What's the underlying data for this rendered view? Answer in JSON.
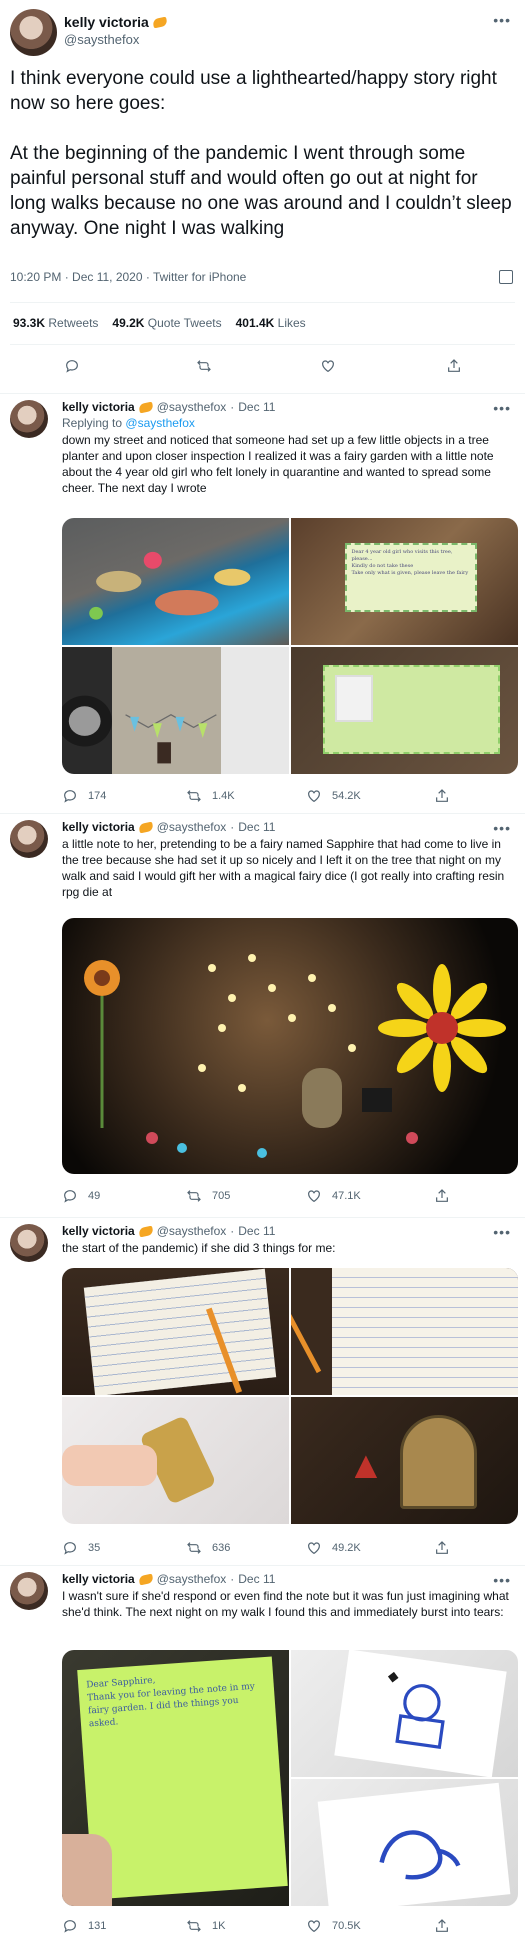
{
  "main": {
    "name": "kelly victoria",
    "handle": "@saysthefox",
    "text": "I think everyone could use a lighthearted/happy story right now so here goes:\n\nAt the beginning of the pandemic I went through some painful personal stuff and would often go out at night for long walks because no one was around and I couldn’t sleep anyway. One night I was walking",
    "meta": "10:20 PM · Dec 11, 2020 · Twitter for iPhone",
    "stats": {
      "retweets": "93.3K",
      "retweets_label": "Retweets",
      "quotes": "49.2K",
      "quotes_label": "Quote Tweets",
      "likes": "401.4K",
      "likes_label": "Likes"
    }
  },
  "replies": [
    {
      "name": "kelly victoria",
      "handle": "@saysthefox",
      "dot": "·",
      "date": "Dec 11",
      "replying_prefix": "Replying to",
      "replying_to": "@saysthefox",
      "text": "down my street and noticed that someone had set up a few little objects in a tree planter and upon closer inspection I realized it was a fairy garden with a little note about the 4 year old girl who felt lonely in quarantine and wanted to spread some cheer. The next day I wrote",
      "image_notes": [
        "Dear 4 year old girl who visits this tree, please...",
        "Kindly do not take these",
        "Take only what is given, please leave the fairy"
      ],
      "counts": {
        "replies": "174",
        "retweets": "1.4K",
        "likes": "54.2K"
      }
    },
    {
      "name": "kelly victoria",
      "handle": "@saysthefox",
      "dot": "·",
      "date": "Dec 11",
      "text": "a little note to her, pretending to be a fairy named Sapphire that had come to live in the tree because she had set it up so nicely and I left it on the tree that night on my walk and said I would gift her with a magical fairy dice (I got really into crafting resin rpg die at",
      "counts": {
        "replies": "49",
        "retweets": "705",
        "likes": "47.1K"
      }
    },
    {
      "name": "kelly victoria",
      "handle": "@saysthefox",
      "dot": "·",
      "date": "Dec 11",
      "text": "the start of the pandemic) if she did 3 things for me:",
      "counts": {
        "replies": "35",
        "retweets": "636",
        "likes": "49.2K"
      }
    },
    {
      "name": "kelly victoria",
      "handle": "@saysthefox",
      "dot": "·",
      "date": "Dec 11",
      "text": "I wasn't sure if she'd respond or even find the note but it was fun just imagining what she'd think. The next night on my walk I found this and immediately burst into tears:",
      "letter_text": "Dear Sapphire,\nThank you for leaving the note in my fairy garden. I did the things you asked.",
      "counts": {
        "replies": "131",
        "retweets": "1K",
        "likes": "70.5K"
      }
    }
  ],
  "colors": {
    "accent": "#1d9bf0",
    "muted": "#536471",
    "text": "#0f1419",
    "border": "#eff3f4"
  }
}
